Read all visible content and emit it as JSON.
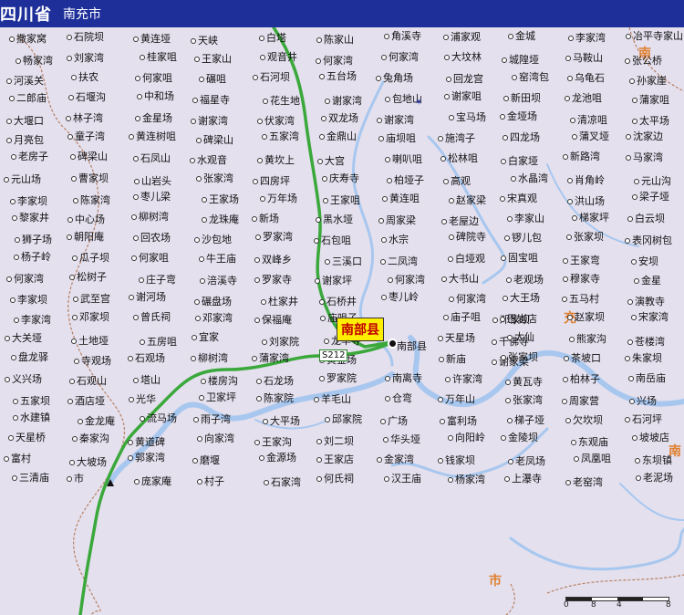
{
  "header": {
    "province": "四川省",
    "city": "南充市"
  },
  "county": {
    "label": "南部县",
    "small_label": "南部县"
  },
  "road": {
    "label": "S212"
  },
  "regions": [
    "南",
    "充",
    "市",
    "南"
  ],
  "scale": {
    "marks": [
      "0",
      "8",
      "4",
      "8"
    ]
  },
  "colors": {
    "background": "#e4e0ee",
    "river": "#a8c7ef",
    "highway": "#3aa83a",
    "border": "#b88060",
    "title_bar": "#1f2f9a"
  },
  "places": [
    "撒家窝",
    "石院坝",
    "黄连垭",
    "天峡",
    "白塔",
    "陈家山",
    "角溪寺",
    "浦家观",
    "金城",
    "李家湾",
    "冶平寺家山",
    "畅家湾",
    "刘家湾",
    "桂家咀",
    "王家山",
    "观音井",
    "何家湾",
    "何家湾",
    "大坟林",
    "城隍垭",
    "马鞍山",
    "张公桥",
    "河溪关",
    "扶农",
    "何家咀",
    "碾咀",
    "石河坝",
    "五台场",
    "兔角场",
    "回龙宫",
    "窑湾包",
    "乌龟石",
    "孙家崖",
    "二郎庙",
    "石堰沟",
    "中和场",
    "福星寺",
    "花生地",
    "谢家湾",
    "包地山",
    "谢家咀",
    "新田坝",
    "龙池咀",
    "蒲家咀",
    "大堰口",
    "林子湾",
    "金星场",
    "谢家湾",
    "伏家湾",
    "双龙场",
    "谢家湾",
    "宝马场",
    "金垭场",
    "清凉咀",
    "太平场",
    "月亮包",
    "童子湾",
    "黄连树咀",
    "碑梁山",
    "五家湾",
    "金鼎山",
    "庙坝咀",
    "施湾子",
    "四龙场",
    "蒲叉垭",
    "沈家边",
    "老房子",
    "碑梁山",
    "石凤山",
    "水观音",
    "黄坎上",
    "大宫",
    "喇叭咀",
    "松林咀",
    "白家垭",
    "新路湾",
    "马家湾",
    "元山场",
    "曹家坝",
    "山岩头",
    "张家湾",
    "四房坪",
    "庆寿寺",
    "柏垭子",
    "高观",
    "水晶湾",
    "肖角岭",
    "元山沟",
    "李家坝",
    "陈家湾",
    "枣儿梁",
    "王家场",
    "万年场",
    "王家咀",
    "黄连咀",
    "赵家梁",
    "宋真观",
    "洪山场",
    "梁子垭",
    "黎家井",
    "中心场",
    "柳树湾",
    "龙珠庵",
    "新场",
    "黑水垭",
    "周家梁",
    "老屋边",
    "李家山",
    "梯家坪",
    "白云坝",
    "狮子场",
    "朝阳庵",
    "回农场",
    "沙包地",
    "罗家湾",
    "石包咀",
    "水宗",
    "碑院寺",
    "锣儿包",
    "张家坝",
    "表冈树包",
    "杨子岭",
    "瓜子坝",
    "何家咀",
    "牛王庙",
    "双峰乡",
    "三溪口",
    "二凤湾",
    "白垭观",
    "固宝咀",
    "王家弯",
    "安坝",
    "何家湾",
    "松树子",
    "庄子弯",
    "涪溪寺",
    "罗家寺",
    "谢家坪",
    "何家湾",
    "大书山",
    "老观场",
    "穆家寺",
    "金星",
    "李家坝",
    "武至宫",
    "谢河场",
    "碾盘场",
    "杜家井",
    "石桥井",
    "枣儿岭",
    "何家湾",
    "大王场",
    "五马村",
    "演教寺",
    "李家湾",
    "邓家坝",
    "曾氏祠",
    "邓家湾",
    "保福庵",
    "庙咀子",
    "邓家坝",
    "庙子咀",
    "巴岩店",
    "赵家坝",
    "宋家湾",
    "大关垭",
    "土地垭",
    "五房咀",
    "宜家",
    "刘家院",
    "龙华寺",
    "千佛寺",
    "天星场",
    "太仙",
    "熊家沟",
    "苍楼湾",
    "盘龙驿",
    "寺观场",
    "石观场",
    "柳树湾",
    "蒲家湾",
    "黄金场",
    "谢家梁",
    "新庙",
    "张家坝",
    "茶坡口",
    "朱家坝",
    "义兴场",
    "石观山",
    "塔山",
    "楼房沟",
    "石龙场",
    "罗家院",
    "南离寺",
    "许家湾",
    "黄瓦寺",
    "柏林子",
    "南岳庙",
    "五家坝",
    "酒店垭",
    "光华",
    "卫家坪",
    "陈家院",
    "羊毛山",
    "仓弯",
    "万年山",
    "张家湾",
    "周家营",
    "兴场",
    "水建镇",
    "金龙庵",
    "流马场",
    "雨子湾",
    "大平场",
    "邱家院",
    "广场",
    "富利场",
    "梯子垭",
    "欠坎坝",
    "石河坪",
    "天星桥",
    "秦家沟",
    "黄道碑",
    "向家湾",
    "王家沟",
    "刘二坝",
    "华头垭",
    "向阳岭",
    "金陵坝",
    "东观庙",
    "坡坡店",
    "富村",
    "大坡场",
    "郭家湾",
    "磨堰",
    "金源场",
    "王家店",
    "金家湾",
    "钱家坝",
    "老凤场",
    "凤凰咀",
    "东坝镇",
    "三清庙",
    "市",
    "庞家庵",
    "村子",
    "石家湾",
    "何氏祠",
    "汉王庙",
    "杨家湾",
    "上瀑寺",
    "老窑湾",
    "老泥场"
  ]
}
